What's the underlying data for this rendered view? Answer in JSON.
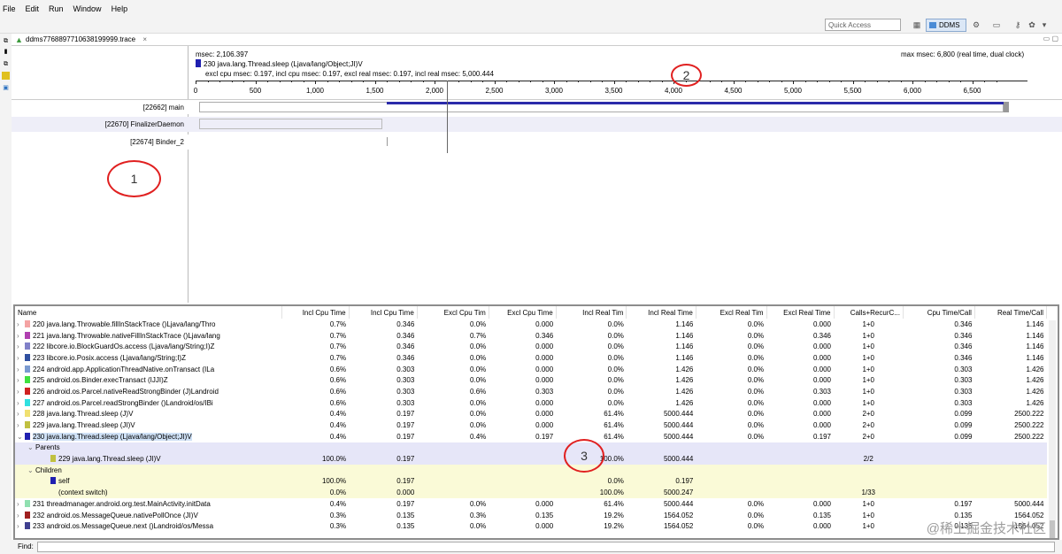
{
  "menu": [
    "File",
    "Edit",
    "Run",
    "Window",
    "Help"
  ],
  "toolbar": {
    "quick_access": "Quick Access",
    "ddms_label": "DDMS"
  },
  "editor_tab": {
    "title": "ddms7768897710638199999.trace",
    "close": "×"
  },
  "timeline": {
    "msec": "msec: 2,106.397",
    "selected_method": "230 java.lang.Thread.sleep (Ljava/lang/Object;JI)V",
    "stats": "excl cpu msec: 0.197, incl cpu msec: 0.197, excl real msec: 0.197, incl real msec: 5,000.444",
    "max_msec": "max msec: 6,800 (real time, dual clock)",
    "axis": {
      "min": 0,
      "max": 6800,
      "ticks": [
        {
          "value": 0,
          "label": "0"
        },
        {
          "value": 500,
          "label": "500"
        },
        {
          "value": 1000,
          "label": "1,000"
        },
        {
          "value": 1500,
          "label": "1,500"
        },
        {
          "value": 2000,
          "label": "2,000"
        },
        {
          "value": 2500,
          "label": "2,500"
        },
        {
          "value": 3000,
          "label": "3,000"
        },
        {
          "value": 3500,
          "label": "3,500"
        },
        {
          "value": 4000,
          "label": "4,000"
        },
        {
          "value": 4500,
          "label": "4,500"
        },
        {
          "value": 5000,
          "label": "5,000"
        },
        {
          "value": 5500,
          "label": "5,500"
        },
        {
          "value": 6000,
          "label": "6,000"
        },
        {
          "value": 6500,
          "label": "6,500"
        }
      ],
      "cursor": 2106.397
    },
    "threads": [
      {
        "label": "[22662] main",
        "segments": [
          {
            "start": 1600,
            "end": 6760,
            "color": "#2b2baa"
          }
        ]
      },
      {
        "label": "[22670] FinalizerDaemon",
        "segments": [
          {
            "start": 30,
            "end": 1560,
            "color": "#bbbbbb"
          }
        ]
      },
      {
        "label": "[22674] Binder_2",
        "segments": [
          {
            "start": 1600,
            "end": 1610,
            "color": "#999999"
          }
        ]
      }
    ]
  },
  "annotations": [
    "1",
    "2",
    "3"
  ],
  "profile": {
    "columns": [
      "Name",
      "Incl Cpu Time",
      "Incl Cpu Time",
      "Excl Cpu Tim",
      "Excl Cpu Time",
      "Incl Real Tim",
      "Incl Real Time",
      "Excl Real Tim",
      "Excl Real Time",
      "Calls+RecurC...",
      "Cpu Time/Call",
      "Real Time/Call"
    ],
    "rows": [
      {
        "type": "row",
        "arrow": "›",
        "color": "#f4a3a3",
        "name": "220 java.lang.Throwable.fillInStackTrace ()Ljava/lang/Thro",
        "v": [
          "0.7%",
          "0.346",
          "0.0%",
          "0.000",
          "0.0%",
          "1.146",
          "0.0%",
          "0.000",
          "1+0",
          "0.346",
          "1.146"
        ]
      },
      {
        "type": "row",
        "arrow": "›",
        "color": "#b040b0",
        "name": "221 java.lang.Throwable.nativeFillInStackTrace ()Ljava/lang",
        "v": [
          "0.7%",
          "0.346",
          "0.7%",
          "0.346",
          "0.0%",
          "1.146",
          "0.0%",
          "0.346",
          "1+0",
          "0.346",
          "1.146"
        ]
      },
      {
        "type": "row",
        "arrow": "›",
        "color": "#8080c8",
        "name": "222 libcore.io.BlockGuardOs.access (Ljava/lang/String;I)Z",
        "v": [
          "0.7%",
          "0.346",
          "0.0%",
          "0.000",
          "0.0%",
          "1.146",
          "0.0%",
          "0.000",
          "1+0",
          "0.346",
          "1.146"
        ]
      },
      {
        "type": "row",
        "arrow": "›",
        "color": "#3050a0",
        "name": "223 libcore.io.Posix.access (Ljava/lang/String;I)Z",
        "v": [
          "0.7%",
          "0.346",
          "0.0%",
          "0.000",
          "0.0%",
          "1.146",
          "0.0%",
          "0.000",
          "1+0",
          "0.346",
          "1.146"
        ]
      },
      {
        "type": "row",
        "arrow": "›",
        "color": "#7a9ad0",
        "name": "224 android.app.ApplicationThreadNative.onTransact (ILa",
        "v": [
          "0.6%",
          "0.303",
          "0.0%",
          "0.000",
          "0.0%",
          "1.426",
          "0.0%",
          "0.000",
          "1+0",
          "0.303",
          "1.426"
        ]
      },
      {
        "type": "row",
        "arrow": "›",
        "color": "#40e040",
        "name": "225 android.os.Binder.execTransact (IJJI)Z",
        "v": [
          "0.6%",
          "0.303",
          "0.0%",
          "0.000",
          "0.0%",
          "1.426",
          "0.0%",
          "0.000",
          "1+0",
          "0.303",
          "1.426"
        ]
      },
      {
        "type": "row",
        "arrow": "›",
        "color": "#d02020",
        "name": "226 android.os.Parcel.nativeReadStrongBinder (J)Landroid",
        "v": [
          "0.6%",
          "0.303",
          "0.6%",
          "0.303",
          "0.0%",
          "1.426",
          "0.0%",
          "0.303",
          "1+0",
          "0.303",
          "1.426"
        ]
      },
      {
        "type": "row",
        "arrow": "›",
        "color": "#30e0e0",
        "name": "227 android.os.Parcel.readStrongBinder ()Landroid/os/IBi",
        "v": [
          "0.6%",
          "0.303",
          "0.0%",
          "0.000",
          "0.0%",
          "1.426",
          "0.0%",
          "0.000",
          "1+0",
          "0.303",
          "1.426"
        ]
      },
      {
        "type": "row",
        "arrow": "›",
        "color": "#f0e070",
        "name": "228 java.lang.Thread.sleep (J)V",
        "v": [
          "0.4%",
          "0.197",
          "0.0%",
          "0.000",
          "61.4%",
          "5000.444",
          "0.0%",
          "0.000",
          "2+0",
          "0.099",
          "2500.222"
        ]
      },
      {
        "type": "row",
        "arrow": "›",
        "color": "#c0c040",
        "name": "229 java.lang.Thread.sleep (JI)V",
        "v": [
          "0.4%",
          "0.197",
          "0.0%",
          "0.000",
          "61.4%",
          "5000.444",
          "0.0%",
          "0.000",
          "2+0",
          "0.099",
          "2500.222"
        ]
      },
      {
        "type": "sel",
        "arrow": "⌄",
        "color": "#2020b0",
        "name": "230 java.lang.Thread.sleep (Ljava/lang/Object;JI)V",
        "v": [
          "0.4%",
          "0.197",
          "0.4%",
          "0.197",
          "61.4%",
          "5000.444",
          "0.0%",
          "0.197",
          "2+0",
          "0.099",
          "2500.222"
        ]
      },
      {
        "type": "parents-head",
        "arrow": "⌄",
        "name": "Parents"
      },
      {
        "type": "parents",
        "color": "#c0c040",
        "name": "229 java.lang.Thread.sleep (JI)V",
        "v": [
          "100.0%",
          "0.197",
          "",
          "",
          "100.0%",
          "5000.444",
          "",
          "",
          "2/2",
          "",
          ""
        ]
      },
      {
        "type": "children-head",
        "arrow": "⌄",
        "name": "Children"
      },
      {
        "type": "children",
        "color": "#2020b0",
        "name": "self",
        "v": [
          "100.0%",
          "0.197",
          "",
          "",
          "0.0%",
          "0.197",
          "",
          "",
          "",
          "",
          ""
        ]
      },
      {
        "type": "children",
        "name": "(context switch)",
        "v": [
          "0.0%",
          "0.000",
          "",
          "",
          "100.0%",
          "5000.247",
          "",
          "",
          "1/33",
          "",
          ""
        ]
      },
      {
        "type": "row",
        "arrow": "›",
        "color": "#90e0b0",
        "name": "231 threadmanager.android.org.test.MainActivity.initData",
        "v": [
          "0.4%",
          "0.197",
          "0.0%",
          "0.000",
          "61.4%",
          "5000.444",
          "0.0%",
          "0.000",
          "1+0",
          "0.197",
          "5000.444"
        ]
      },
      {
        "type": "row",
        "arrow": "›",
        "color": "#a02020",
        "name": "232 android.os.MessageQueue.nativePollOnce (JI)V",
        "v": [
          "0.3%",
          "0.135",
          "0.3%",
          "0.135",
          "19.2%",
          "1564.052",
          "0.0%",
          "0.135",
          "1+0",
          "0.135",
          "1564.052"
        ]
      },
      {
        "type": "row",
        "arrow": "›",
        "color": "#404090",
        "name": "233 android.os.MessageQueue.next ()Landroid/os/Messa",
        "v": [
          "0.3%",
          "0.135",
          "0.0%",
          "0.000",
          "19.2%",
          "1564.052",
          "0.0%",
          "0.000",
          "1+0",
          "0.135",
          "1564.052"
        ]
      }
    ]
  },
  "find": {
    "label": "Find:"
  },
  "watermark": "@稀土掘金技术社区"
}
